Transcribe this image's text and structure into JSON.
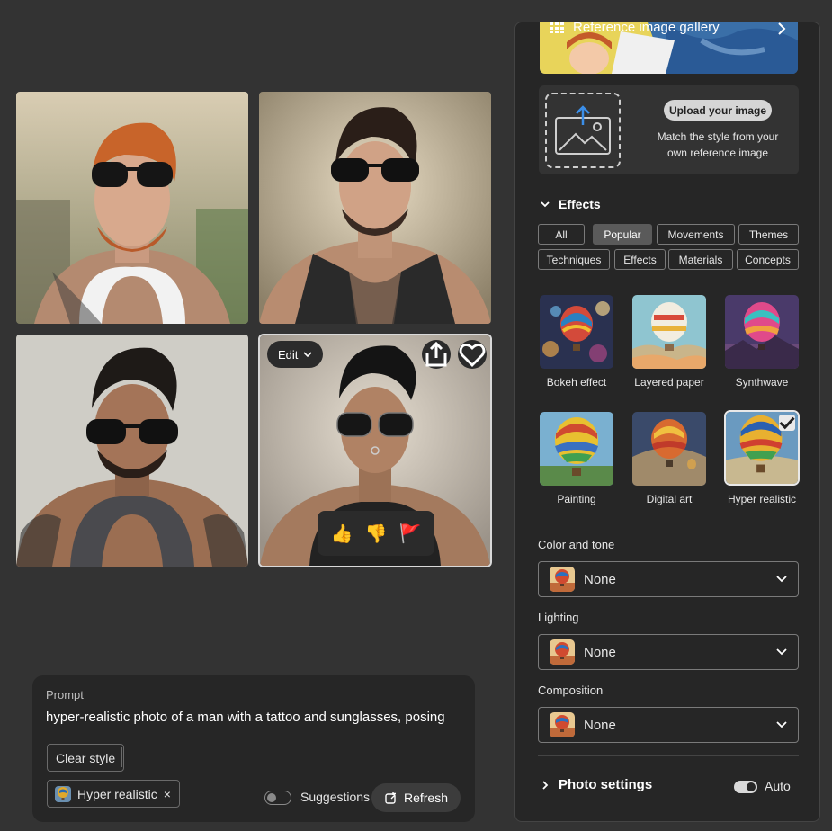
{
  "grid": {
    "edit_label": "Edit",
    "feedback": {
      "like": "👍",
      "dislike": "👎",
      "report": "🚩"
    }
  },
  "prompt": {
    "label": "Prompt",
    "text": "hyper-realistic photo of a man with a tattoo and sunglasses, posing",
    "clear_style": "Clear style",
    "style_chip": "Hyper realistic",
    "remove_glyph": "×",
    "suggestions_label": "Suggestions",
    "refresh_label": "Refresh"
  },
  "panel": {
    "gallery_title": "Reference image gallery",
    "upload_button": "Upload your image",
    "upload_desc": "Match the style from your own reference image",
    "effects_title": "Effects",
    "filters": [
      "All",
      "Popular",
      "Movements",
      "Themes",
      "Techniques",
      "Effects",
      "Materials",
      "Concepts"
    ],
    "active_filter": "Popular",
    "effects": [
      {
        "label": "Bokeh effect"
      },
      {
        "label": "Layered paper"
      },
      {
        "label": "Synthwave"
      },
      {
        "label": "Painting"
      },
      {
        "label": "Digital art"
      },
      {
        "label": "Hyper realistic"
      }
    ],
    "selected_effect": "Hyper realistic",
    "color_tone_label": "Color and tone",
    "color_tone_value": "None",
    "lighting_label": "Lighting",
    "lighting_value": "None",
    "composition_label": "Composition",
    "composition_value": "None",
    "photo_settings_label": "Photo settings",
    "auto_label": "Auto"
  },
  "colors": {
    "background": "#333333",
    "panel": "#262626",
    "accent": "#d9d9d9"
  }
}
